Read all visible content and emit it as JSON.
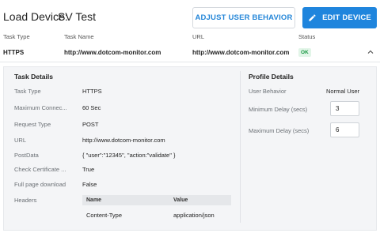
{
  "header": {
    "title_label": "Load Device:",
    "title_name": "SV Test",
    "adjust_button": "ADJUST USER BEHAVIOR",
    "edit_button": "EDIT DEVICE"
  },
  "table": {
    "columns": [
      "Task Type",
      "Task Name",
      "URL",
      "Status"
    ],
    "row": {
      "task_type": "HTTPS",
      "task_name": "http://www.dotcom-monitor.com",
      "url": "http://www.dotcom-monitor.com",
      "status": "OK"
    }
  },
  "task_details": {
    "title": "Task Details",
    "fields": [
      {
        "label": "Task Type",
        "value": "HTTPS"
      },
      {
        "label": "Maximum Connec...",
        "value": "60 Sec"
      },
      {
        "label": "Request Type",
        "value": "POST"
      },
      {
        "label": "URL",
        "value": "http://www.dotcom-monitor.com"
      },
      {
        "label": "PostData",
        "value": "{ \"user\":\"12345\", \"action:\"validate\" }"
      },
      {
        "label": "Check Certificate ...",
        "value": "True"
      },
      {
        "label": "Full page download",
        "value": "False"
      }
    ],
    "headers_label": "Headers",
    "headers_table": {
      "columns": [
        "Name",
        "Value"
      ],
      "rows": [
        {
          "name": "Content-Type",
          "value": "application/json"
        }
      ]
    }
  },
  "profile_details": {
    "title": "Profile Details",
    "user_behavior_label": "User Behavior",
    "user_behavior_value": "Normal User",
    "min_delay_label": "Minimum Delay (secs)",
    "min_delay_value": "3",
    "max_delay_label": "Maximum Delay (secs)",
    "max_delay_value": "6"
  },
  "colors": {
    "accent": "#1f85dd",
    "status_ok": "#1e9a46",
    "panel_bg": "#f4f5f7"
  },
  "icons": {
    "edit": "pencil-icon",
    "collapse": "chevron-up-icon"
  }
}
